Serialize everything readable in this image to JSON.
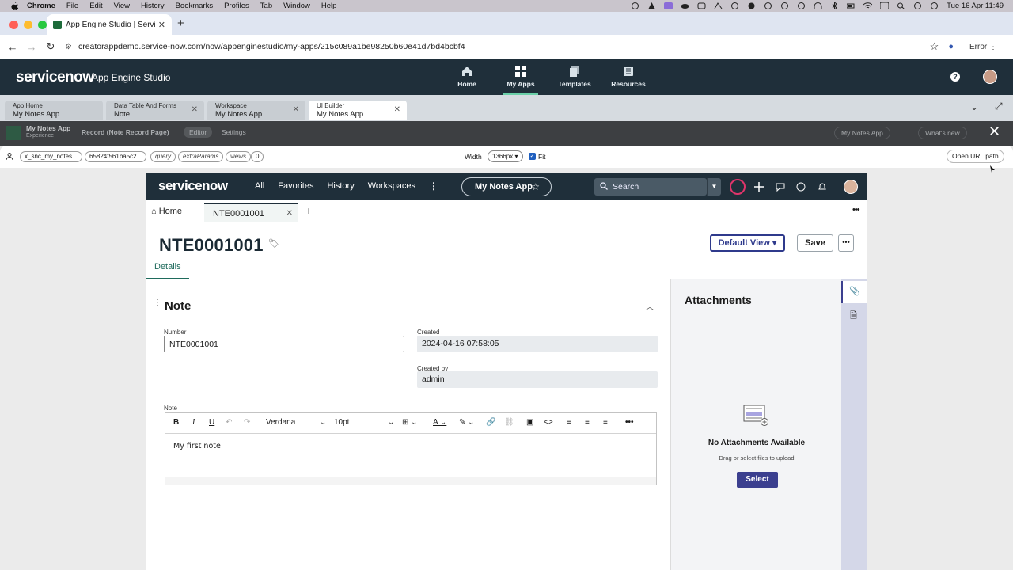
{
  "mac": {
    "app": "Chrome",
    "menus": [
      "File",
      "Edit",
      "View",
      "History",
      "Bookmarks",
      "Profiles",
      "Tab",
      "Window",
      "Help"
    ],
    "datetime": "Tue 16 Apr  11:49"
  },
  "browser": {
    "tab_title": "App Engine Studio | ServiceN",
    "url": "creatorappdemo.service-now.com/now/appenginestudio/my-apps/215c089a1be98250b60e41d7bd4bcbf4",
    "error_label": "Error"
  },
  "studio": {
    "logo": "servicenow",
    "title": "App Engine Studio",
    "nav": [
      {
        "label": "Home",
        "icon": "home-icon"
      },
      {
        "label": "My Apps",
        "icon": "apps-grid-icon"
      },
      {
        "label": "Templates",
        "icon": "templates-icon"
      },
      {
        "label": "Resources",
        "icon": "resources-icon"
      }
    ],
    "tabs": [
      {
        "small": "App Home",
        "big": "My Notes App"
      },
      {
        "small": "Data Table And Forms",
        "big": "Note"
      },
      {
        "small": "Workspace",
        "big": "My Notes App"
      },
      {
        "small": "UI Builder",
        "big": "My Notes App"
      }
    ]
  },
  "builder_bar": {
    "app": "My Notes App",
    "experience": "Experience",
    "record": "Record (Note Record Page)",
    "editor": "Editor",
    "settings": "Settings",
    "app_select": "My Notes App",
    "whats_new": "What's new"
  },
  "params": {
    "chips": [
      "x_snc_my_notes...",
      "65824f561ba5c2...",
      "query",
      "extraParams",
      "views",
      "0"
    ],
    "width_label": "Width",
    "width_value": "1366px",
    "fit_label": "Fit",
    "open_url": "Open URL path"
  },
  "page": {
    "logo": "servicenow",
    "menu": [
      "All",
      "Favorites",
      "History",
      "Workspaces"
    ],
    "app_pill": "My Notes App",
    "search_label": "Search",
    "home_tab": "Home",
    "record_tab": "NTE0001001",
    "record_title": "NTE0001001",
    "default_view": "Default View",
    "save": "Save",
    "details_tab": "Details",
    "section_title": "Note",
    "fields": {
      "number_label": "Number",
      "number_value": "NTE0001001",
      "created_label": "Created",
      "created_value": "2024-04-16 07:58:05",
      "created_by_label": "Created by",
      "created_by_value": "admin",
      "note_label": "Note"
    },
    "editor": {
      "font": "Verdana",
      "size": "10pt",
      "content": "My first note"
    },
    "attachments": {
      "title": "Attachments",
      "empty": "No Attachments Available",
      "sub": "Drag or select files to upload",
      "select": "Select"
    }
  },
  "colors": {
    "nav_bg": "#1f2f3a",
    "accent_purple": "#3b3f8f",
    "active_green": "#1f6b5c",
    "globe_ring": "#e0356b"
  }
}
